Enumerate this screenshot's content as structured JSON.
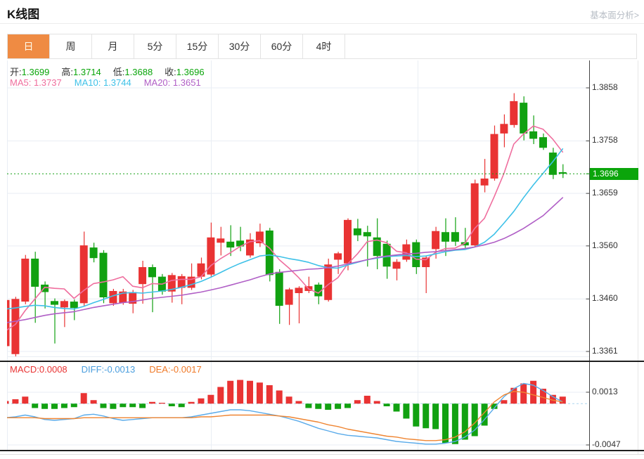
{
  "header": {
    "title": "K线图",
    "link": "基本面分析>"
  },
  "tabs": {
    "items": [
      {
        "label": "日",
        "selected": true
      },
      {
        "label": "周",
        "selected": false
      },
      {
        "label": "月",
        "selected": false
      },
      {
        "label": "5分",
        "selected": false
      },
      {
        "label": "15分",
        "selected": false
      },
      {
        "label": "30分",
        "selected": false
      },
      {
        "label": "60分",
        "selected": false
      },
      {
        "label": "4时",
        "selected": false
      }
    ]
  },
  "quote_bar": {
    "open_label": "开:",
    "open": "1.3699",
    "high_label": "高:",
    "high": "1.3714",
    "low_label": "低:",
    "low": "1.3688",
    "close_label": "收:",
    "close": "1.3696"
  },
  "ma_bar": {
    "ma5_label": "MA5:",
    "ma5": "1.3737",
    "ma10_label": "MA10:",
    "ma10": "1.3744",
    "ma20_label": "MA20:",
    "ma20": "1.3651"
  },
  "macd_bar": {
    "macd_label": "MACD:",
    "macd": "0.0008",
    "diff_label": "DIFF:",
    "diff": "-0.0013",
    "dea_label": "DEA:",
    "dea": "-0.0017"
  },
  "price_marker": "1.3696",
  "colors": {
    "up": "#e93333",
    "down": "#11a111",
    "ma5": "#ef6e9e",
    "ma10": "#3ec1e8",
    "ma20": "#b05fc6",
    "diff_line": "#5aabea",
    "dea_line": "#ef8532",
    "tab_active_bg": "#ef8b43",
    "price_marker_bg": "#0ba50b",
    "grid": "#e9eef4",
    "axis": "#444444",
    "current_line": "#12a012",
    "zero_line": "#aed5ef"
  },
  "chart_data": [
    {
      "type": "candlestick",
      "panel": "main",
      "title": "K线图 日线",
      "y_ticks": [
        1.3858,
        1.3758,
        1.3659,
        1.356,
        1.346,
        1.3361
      ],
      "ylim": [
        1.3346,
        1.388
      ],
      "current_price": 1.3696,
      "ohlc": [
        [
          1.3371,
          1.3462,
          1.336,
          1.3458
        ],
        [
          1.3356,
          1.3464,
          1.3346,
          1.346
        ],
        [
          1.3455,
          1.3543,
          1.345,
          1.3536
        ],
        [
          1.3536,
          1.3549,
          1.3415,
          1.3483
        ],
        [
          1.3487,
          1.3493,
          1.3442,
          1.3473
        ],
        [
          1.3456,
          1.3461,
          1.3376,
          1.3449
        ],
        [
          1.3444,
          1.3459,
          1.3407,
          1.3456
        ],
        [
          1.3455,
          1.3459,
          1.342,
          1.3443
        ],
        [
          1.3452,
          1.3587,
          1.3447,
          1.3561
        ],
        [
          1.3557,
          1.3566,
          1.3529,
          1.3537
        ],
        [
          1.3547,
          1.3552,
          1.3452,
          1.3463
        ],
        [
          1.3452,
          1.3479,
          1.3447,
          1.3475
        ],
        [
          1.3453,
          1.3479,
          1.3449,
          1.3474
        ],
        [
          1.3451,
          1.3477,
          1.3433,
          1.3473
        ],
        [
          1.3488,
          1.3532,
          1.3451,
          1.352
        ],
        [
          1.352,
          1.3525,
          1.3435,
          1.3501
        ],
        [
          1.3502,
          1.3507,
          1.3468,
          1.3474
        ],
        [
          1.3474,
          1.3509,
          1.3453,
          1.3505
        ],
        [
          1.3481,
          1.3507,
          1.345,
          1.3503
        ],
        [
          1.3481,
          1.3527,
          1.3477,
          1.3502
        ],
        [
          1.3502,
          1.3538,
          1.3497,
          1.3527
        ],
        [
          1.3506,
          1.3604,
          1.3501,
          1.3576
        ],
        [
          1.3566,
          1.3596,
          1.3542,
          1.3574
        ],
        [
          1.3568,
          1.3599,
          1.3541,
          1.3557
        ],
        [
          1.357,
          1.3596,
          1.355,
          1.3559
        ],
        [
          1.3542,
          1.3584,
          1.3538,
          1.3572
        ],
        [
          1.3565,
          1.3602,
          1.3558,
          1.3587
        ],
        [
          1.3589,
          1.3594,
          1.3493,
          1.3505
        ],
        [
          1.3511,
          1.3516,
          1.3413,
          1.3447
        ],
        [
          1.3449,
          1.3481,
          1.3411,
          1.3478
        ],
        [
          1.3471,
          1.3484,
          1.3414,
          1.3481
        ],
        [
          1.3475,
          1.3502,
          1.3471,
          1.3484
        ],
        [
          1.3487,
          1.3491,
          1.345,
          1.3465
        ],
        [
          1.3458,
          1.3536,
          1.3455,
          1.3525
        ],
        [
          1.3534,
          1.3549,
          1.3507,
          1.3546
        ],
        [
          1.3527,
          1.3612,
          1.3514,
          1.3609
        ],
        [
          1.3593,
          1.3611,
          1.3569,
          1.358
        ],
        [
          1.3586,
          1.3598,
          1.3521,
          1.3578
        ],
        [
          1.3576,
          1.3612,
          1.3516,
          1.3541
        ],
        [
          1.3564,
          1.357,
          1.3498,
          1.3521
        ],
        [
          1.3517,
          1.3535,
          1.3495,
          1.353
        ],
        [
          1.3534,
          1.3572,
          1.353,
          1.3563
        ],
        [
          1.3567,
          1.3572,
          1.3507,
          1.352
        ],
        [
          1.352,
          1.3542,
          1.3471,
          1.3538
        ],
        [
          1.3554,
          1.3596,
          1.3536,
          1.3588
        ],
        [
          1.3586,
          1.3612,
          1.3541,
          1.3568
        ],
        [
          1.3586,
          1.3614,
          1.356,
          1.3568
        ],
        [
          1.3567,
          1.3594,
          1.3556,
          1.3561
        ],
        [
          1.3561,
          1.3685,
          1.3558,
          1.3678
        ],
        [
          1.3674,
          1.3724,
          1.3661,
          1.3687
        ],
        [
          1.3687,
          1.3787,
          1.3683,
          1.3771
        ],
        [
          1.3772,
          1.3808,
          1.3746,
          1.379
        ],
        [
          1.3788,
          1.3848,
          1.3783,
          1.3833
        ],
        [
          1.383,
          1.3842,
          1.3759,
          1.3772
        ],
        [
          1.3776,
          1.3806,
          1.3752,
          1.3762
        ],
        [
          1.3765,
          1.3772,
          1.3741,
          1.3745
        ],
        [
          1.3736,
          1.3745,
          1.3686,
          1.3694
        ],
        [
          1.3699,
          1.3714,
          1.3688,
          1.3696
        ]
      ],
      "series": [
        {
          "name": "MA5",
          "color_key": "ma5",
          "values": [
            1.34,
            1.3412,
            1.3438,
            1.346,
            1.3482,
            1.348,
            1.3479,
            1.3461,
            1.3476,
            1.3489,
            1.3492,
            1.3496,
            1.3502,
            1.3484,
            1.3481,
            1.3489,
            1.3488,
            1.3495,
            1.3497,
            1.3497,
            1.3502,
            1.3523,
            1.3536,
            1.3547,
            1.3559,
            1.3568,
            1.357,
            1.3556,
            1.3534,
            1.3518,
            1.35,
            1.3479,
            1.3471,
            1.3487,
            1.35,
            1.3526,
            1.3545,
            1.3568,
            1.3571,
            1.3566,
            1.355,
            1.3547,
            1.3535,
            1.3534,
            1.3548,
            1.3555,
            1.3556,
            1.3565,
            1.3593,
            1.3612,
            1.3653,
            1.3697,
            1.3752,
            1.3771,
            1.3786,
            1.378,
            1.3761,
            1.3737
          ]
        },
        {
          "name": "MA10",
          "color_key": "ma10",
          "values": [
            1.3441,
            1.3443,
            1.3446,
            1.3448,
            1.3447,
            1.3444,
            1.3442,
            1.3441,
            1.3446,
            1.3453,
            1.3459,
            1.3466,
            1.3471,
            1.3472,
            1.3471,
            1.3473,
            1.3475,
            1.3478,
            1.3482,
            1.3487,
            1.3493,
            1.3501,
            1.351,
            1.3519,
            1.3527,
            1.3534,
            1.3541,
            1.3543,
            1.354,
            1.3536,
            1.3533,
            1.3529,
            1.3523,
            1.3519,
            1.3518,
            1.3524,
            1.3529,
            1.3534,
            1.3537,
            1.354,
            1.3541,
            1.3542,
            1.354,
            1.3541,
            1.3545,
            1.3549,
            1.3552,
            1.3553,
            1.3558,
            1.3567,
            1.3582,
            1.3603,
            1.3625,
            1.3651,
            1.3675,
            1.3697,
            1.3719,
            1.3743
          ]
        },
        {
          "name": "MA20",
          "color_key": "ma20",
          "values": [
            1.3415,
            1.3418,
            1.3421,
            1.3425,
            1.3429,
            1.3432,
            1.3434,
            1.3436,
            1.344,
            1.3444,
            1.3447,
            1.345,
            1.3453,
            1.3455,
            1.3458,
            1.3461,
            1.3463,
            1.3465,
            1.3467,
            1.347,
            1.3473,
            1.3477,
            1.3481,
            1.3486,
            1.3491,
            1.3496,
            1.3502,
            1.3507,
            1.351,
            1.3512,
            1.3514,
            1.3516,
            1.3517,
            1.3519,
            1.3522,
            1.3526,
            1.353,
            1.3534,
            1.3538,
            1.3541,
            1.3543,
            1.3545,
            1.3546,
            1.3548,
            1.3549,
            1.3551,
            1.3553,
            1.3555,
            1.3558,
            1.3562,
            1.3567,
            1.3574,
            1.3583,
            1.3593,
            1.3605,
            1.3617,
            1.3634,
            1.3651
          ]
        }
      ]
    },
    {
      "type": "bar",
      "panel": "macd",
      "title": "MACD",
      "y_ticks": [
        0.0013,
        -0.0047
      ],
      "zero": 0,
      "histogram": [
        0.0003,
        0.0005,
        0.0008,
        -0.0005,
        -0.0006,
        -0.0006,
        -0.0005,
        -0.0004,
        0.0012,
        0.0004,
        -0.0005,
        -0.0006,
        -0.0004,
        -0.0004,
        -0.0005,
        0.0002,
        0.0001,
        -0.0003,
        -0.0004,
        0.0002,
        0.0006,
        0.001,
        0.0019,
        0.0026,
        0.0027,
        0.0026,
        0.0024,
        0.0021,
        0.0015,
        0.0008,
        0.0003,
        -0.0005,
        -0.0006,
        -0.0007,
        -0.0006,
        -0.0005,
        0.0004,
        0.0009,
        0.0003,
        -0.0003,
        -0.0009,
        -0.0017,
        -0.0026,
        -0.0028,
        -0.0029,
        -0.0045,
        -0.0046,
        -0.0041,
        -0.0037,
        -0.0025,
        -0.0006,
        0.0004,
        0.0018,
        0.0023,
        0.0026,
        0.0017,
        0.001,
        0.0008
      ],
      "series": [
        {
          "name": "DIFF",
          "color_key": "diff_line",
          "values": [
            -0.0016,
            -0.0015,
            -0.0013,
            -0.0015,
            -0.0018,
            -0.0019,
            -0.0018,
            -0.0017,
            -0.0013,
            -0.0012,
            -0.0014,
            -0.0017,
            -0.0019,
            -0.0018,
            -0.0017,
            -0.0016,
            -0.0016,
            -0.0016,
            -0.0016,
            -0.0015,
            -0.0013,
            -0.0011,
            -0.0009,
            -0.0007,
            -0.0007,
            -0.0008,
            -0.001,
            -0.0012,
            -0.0014,
            -0.0017,
            -0.002,
            -0.0024,
            -0.0028,
            -0.0031,
            -0.0034,
            -0.0036,
            -0.0037,
            -0.0038,
            -0.0039,
            -0.0041,
            -0.0043,
            -0.0044,
            -0.0045,
            -0.0046,
            -0.0046,
            -0.0045,
            -0.0043,
            -0.0038,
            -0.003,
            -0.0018,
            -0.0005,
            0.0008,
            0.0017,
            0.0023,
            0.0021,
            0.0015,
            0.0008,
            0.0002
          ]
        },
        {
          "name": "DEA",
          "color_key": "dea_line",
          "values": [
            -0.0016,
            -0.0016,
            -0.0016,
            -0.0016,
            -0.0017,
            -0.0017,
            -0.0017,
            -0.0017,
            -0.0016,
            -0.0016,
            -0.0016,
            -0.0016,
            -0.0016,
            -0.0016,
            -0.0016,
            -0.0016,
            -0.0016,
            -0.0016,
            -0.0016,
            -0.0016,
            -0.0015,
            -0.0015,
            -0.0014,
            -0.0013,
            -0.0013,
            -0.0013,
            -0.0013,
            -0.0013,
            -0.0014,
            -0.0015,
            -0.0017,
            -0.0019,
            -0.0021,
            -0.0024,
            -0.0026,
            -0.0029,
            -0.0031,
            -0.0033,
            -0.0035,
            -0.0037,
            -0.0038,
            -0.004,
            -0.0041,
            -0.0042,
            -0.0042,
            -0.0041,
            -0.0038,
            -0.0032,
            -0.0022,
            -0.001,
            0.0002,
            0.001,
            0.0014,
            0.0013,
            0.001,
            0.0007,
            0.0004,
            0.0002
          ]
        }
      ]
    }
  ]
}
